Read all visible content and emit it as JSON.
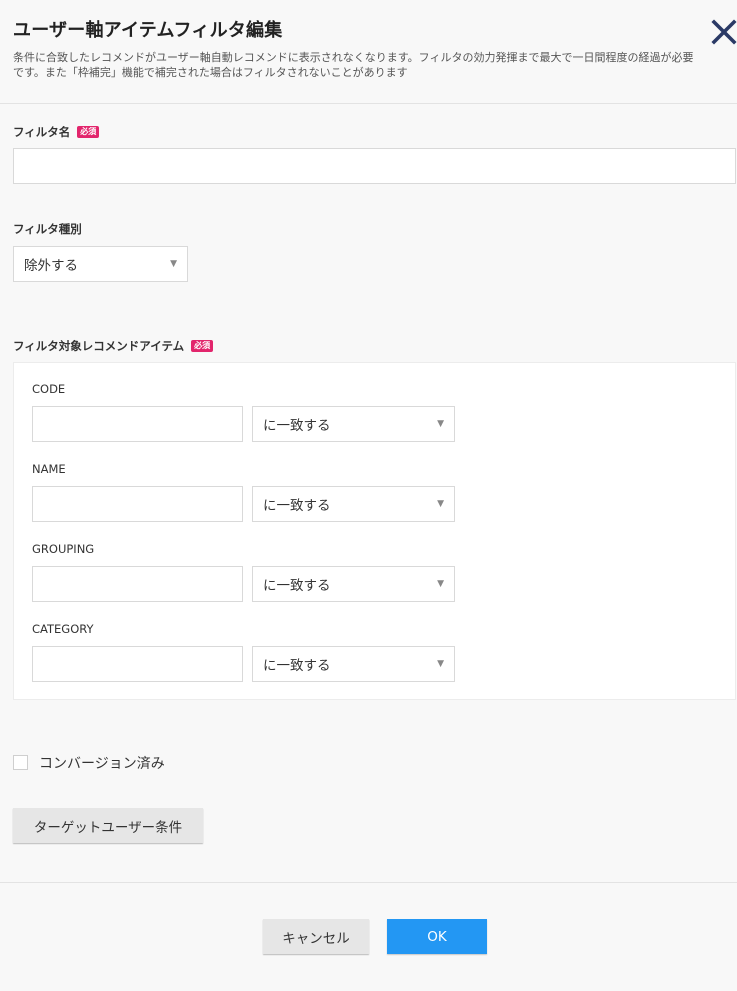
{
  "header": {
    "title": "ユーザー軸アイテムフィルタ編集",
    "description": "条件に合致したレコメンドがユーザー軸自動レコメンドに表示されなくなります。フィルタの効力発揮まで最大で一日間程度の経過が必要です。また「枠補完」機能で補完された場合はフィルタされないことがあります",
    "close_icon": "close-icon"
  },
  "required_badge": "必須",
  "filter_name": {
    "label": "フィルタ名",
    "value": ""
  },
  "filter_type": {
    "label": "フィルタ種別",
    "selected": "除外する"
  },
  "target_items": {
    "label": "フィルタ対象レコメンドアイテム",
    "fields": [
      {
        "label": "CODE",
        "value": "",
        "match": "に一致する"
      },
      {
        "label": "NAME",
        "value": "",
        "match": "に一致する"
      },
      {
        "label": "GROUPING",
        "value": "",
        "match": "に一致する"
      },
      {
        "label": "CATEGORY",
        "value": "",
        "match": "に一致する"
      }
    ]
  },
  "conversion": {
    "label": "コンバージョン済み",
    "checked": false
  },
  "target_user_button": "ターゲットユーザー条件",
  "footer": {
    "cancel": "キャンセル",
    "ok": "OK"
  },
  "colors": {
    "accent": "#2397f3",
    "required": "#e2256c",
    "close": "#2b3a66"
  }
}
